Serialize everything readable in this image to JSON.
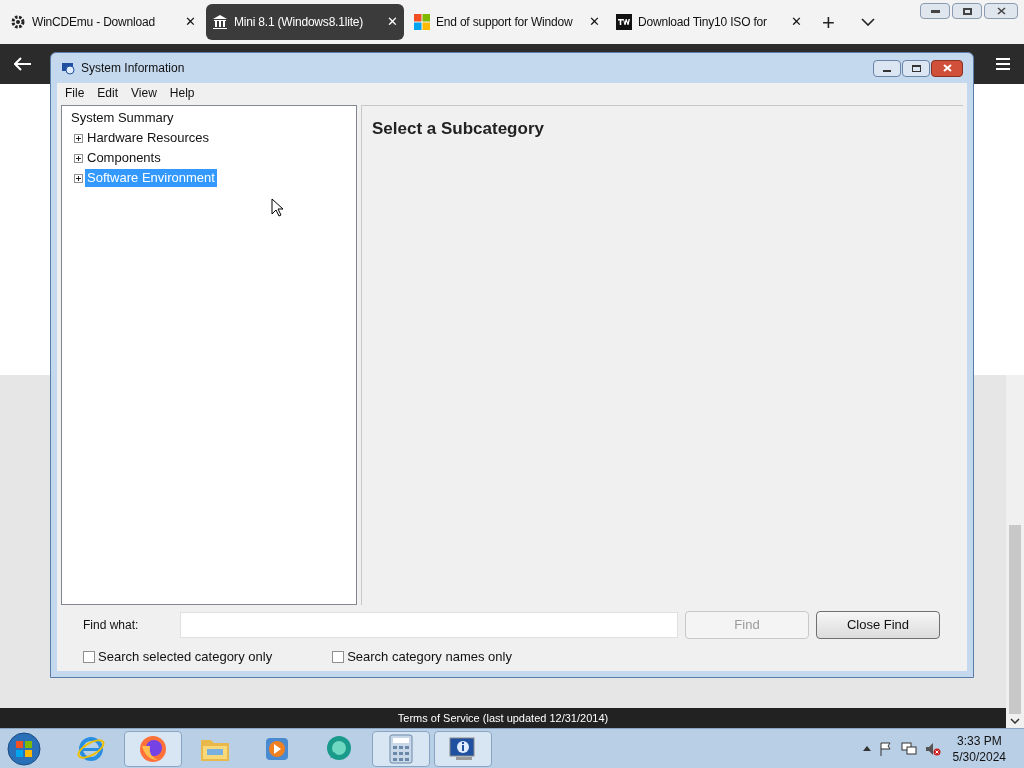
{
  "browser": {
    "tabs": [
      {
        "title": "WinCDEmu - Download",
        "selected": false,
        "close": "✕"
      },
      {
        "title": "Mini 8.1 (Windows8.1lite)",
        "selected": true,
        "close": "✕"
      },
      {
        "title": "End of support for Window",
        "selected": false,
        "close": "✕"
      },
      {
        "title": "Download Tiny10 ISO for",
        "selected": false,
        "close": "✕"
      }
    ],
    "new_tab": "+",
    "footer": "Terms of Service (last updated 12/31/2014)"
  },
  "window": {
    "title": "System Information",
    "menu": [
      "File",
      "Edit",
      "View",
      "Help"
    ],
    "tree": [
      {
        "label": "System Summary",
        "selected": false,
        "children": [
          {
            "label": "Hardware Resources",
            "expanded": false,
            "selected": false
          },
          {
            "label": "Components",
            "expanded": false,
            "selected": false
          },
          {
            "label": "Software Environment",
            "expanded": false,
            "selected": true
          }
        ]
      }
    ],
    "heading": "Select a Subcategory",
    "find": {
      "label": "Find what:",
      "find_button": {
        "label": "Find",
        "disabled": true
      },
      "close_button": {
        "label": "Close Find",
        "disabled": false
      },
      "options": [
        {
          "label": "Search selected category only",
          "checked": false
        },
        {
          "label": "Search category names only",
          "checked": false
        }
      ]
    }
  },
  "taskbar": {
    "apps": [
      {
        "active": false
      },
      {
        "active": true
      },
      {
        "active": false
      },
      {
        "active": false
      },
      {
        "active": false
      },
      {
        "active": true
      },
      {
        "active": true
      }
    ],
    "time": "3:33 PM",
    "date": "5/30/2024"
  }
}
